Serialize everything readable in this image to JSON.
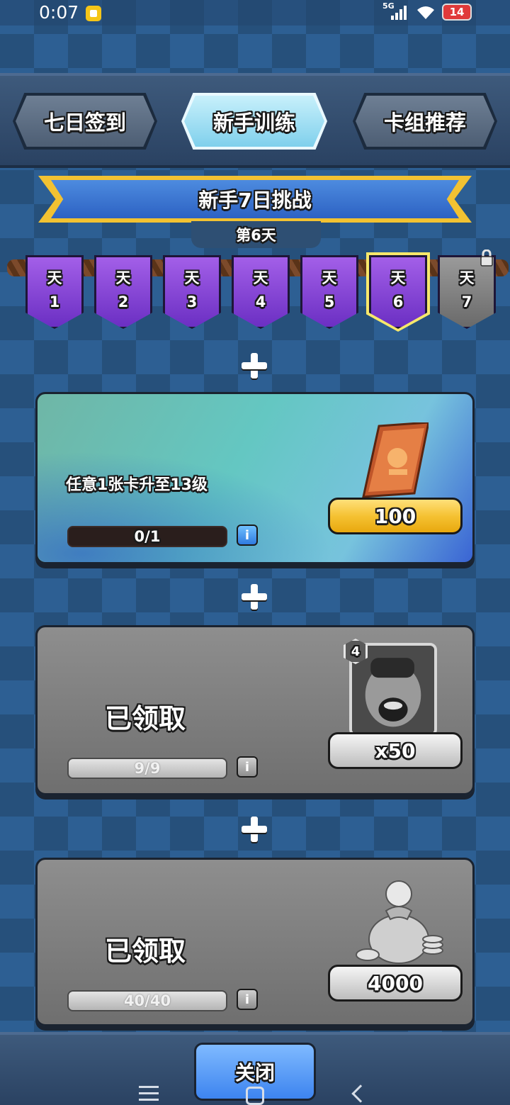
{
  "status_bar": {
    "time": "0:07",
    "network": "5G",
    "battery": "14"
  },
  "tabs": [
    {
      "label": "七日签到",
      "active": false
    },
    {
      "label": "新手训练",
      "active": true
    },
    {
      "label": "卡组推荐",
      "active": false
    }
  ],
  "challenge": {
    "title": "新手7日挑战",
    "current_day_label": "第6天"
  },
  "days": [
    {
      "label": "天",
      "number": "1",
      "state": "done"
    },
    {
      "label": "天",
      "number": "2",
      "state": "done"
    },
    {
      "label": "天",
      "number": "3",
      "state": "done"
    },
    {
      "label": "天",
      "number": "4",
      "state": "done"
    },
    {
      "label": "天",
      "number": "5",
      "state": "done"
    },
    {
      "label": "天",
      "number": "6",
      "state": "current"
    },
    {
      "label": "天",
      "number": "7",
      "state": "locked"
    }
  ],
  "tasks": [
    {
      "description": "任意1张卡升至13级",
      "progress": "0/1",
      "reward": "100",
      "reward_icon": "book-icon",
      "state": "active",
      "info": "i"
    },
    {
      "status": "已领取",
      "progress": "9/9",
      "reward": "x50",
      "reward_icon": "hog-rider-card-icon",
      "card_level": "4",
      "state": "claimed",
      "info": "i"
    },
    {
      "status": "已领取",
      "progress": "40/40",
      "reward": "4000",
      "reward_icon": "coin-bag-icon",
      "state": "claimed",
      "info": "i"
    }
  ],
  "footer": {
    "close_label": "关闭"
  },
  "colors": {
    "accent_blue": "#3d84ef",
    "gold": "#f5c233",
    "purple": "#6b2fc3",
    "background": "#2d5f93"
  }
}
